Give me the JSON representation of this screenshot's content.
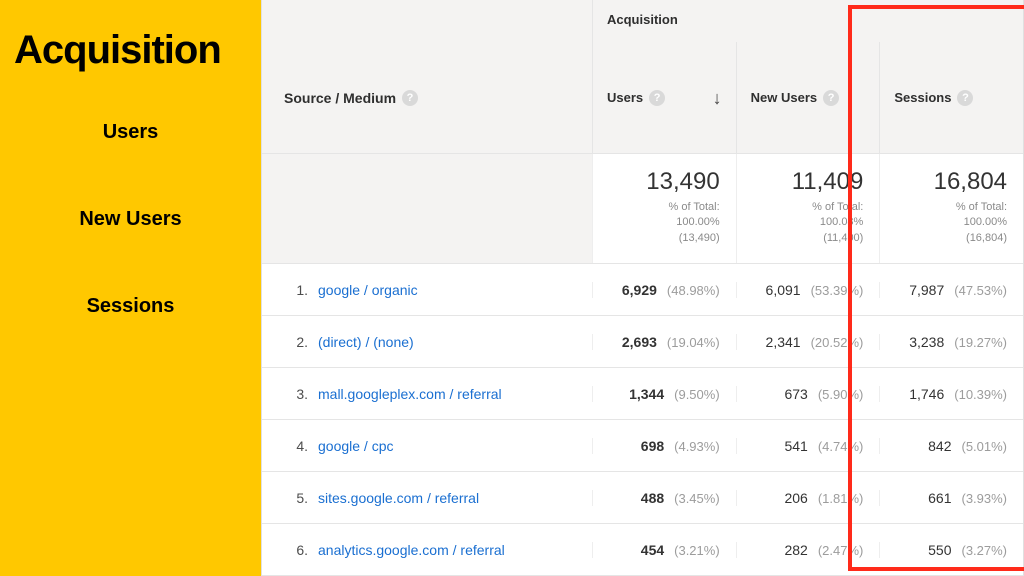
{
  "left": {
    "title": "Acquisition",
    "items": [
      "Users",
      "New Users",
      "Sessions"
    ]
  },
  "header": {
    "group_label": "Acquisition",
    "dimension": "Source / Medium",
    "columns": [
      "Users",
      "New Users",
      "Sessions"
    ]
  },
  "totals": {
    "users": {
      "value": "13,490",
      "pct_line": "% of Total:",
      "pct": "100.00%",
      "base": "(13,490)"
    },
    "new_users": {
      "value": "11,409",
      "pct_line": "% of Total:",
      "pct": "100.08%",
      "base": "(11,400)"
    },
    "sessions": {
      "value": "16,804",
      "pct_line": "% of Total:",
      "pct": "100.00%",
      "base": "(16,804)"
    }
  },
  "rows": [
    {
      "n": "1.",
      "source": "google / organic",
      "users": "6,929",
      "users_pct": "(48.98%)",
      "new": "6,091",
      "new_pct": "(53.39%)",
      "sess": "7,987",
      "sess_pct": "(47.53%)"
    },
    {
      "n": "2.",
      "source": "(direct) / (none)",
      "users": "2,693",
      "users_pct": "(19.04%)",
      "new": "2,341",
      "new_pct": "(20.52%)",
      "sess": "3,238",
      "sess_pct": "(19.27%)"
    },
    {
      "n": "3.",
      "source": "mall.googleplex.com / referral",
      "users": "1,344",
      "users_pct": "(9.50%)",
      "new": "673",
      "new_pct": "(5.90%)",
      "sess": "1,746",
      "sess_pct": "(10.39%)"
    },
    {
      "n": "4.",
      "source": "google / cpc",
      "users": "698",
      "users_pct": "(4.93%)",
      "new": "541",
      "new_pct": "(4.74%)",
      "sess": "842",
      "sess_pct": "(5.01%)"
    },
    {
      "n": "5.",
      "source": "sites.google.com / referral",
      "users": "488",
      "users_pct": "(3.45%)",
      "new": "206",
      "new_pct": "(1.81%)",
      "sess": "661",
      "sess_pct": "(3.93%)"
    },
    {
      "n": "6.",
      "source": "analytics.google.com / referral",
      "users": "454",
      "users_pct": "(3.21%)",
      "new": "282",
      "new_pct": "(2.47%)",
      "sess": "550",
      "sess_pct": "(3.27%)"
    }
  ],
  "help_glyph": "?"
}
